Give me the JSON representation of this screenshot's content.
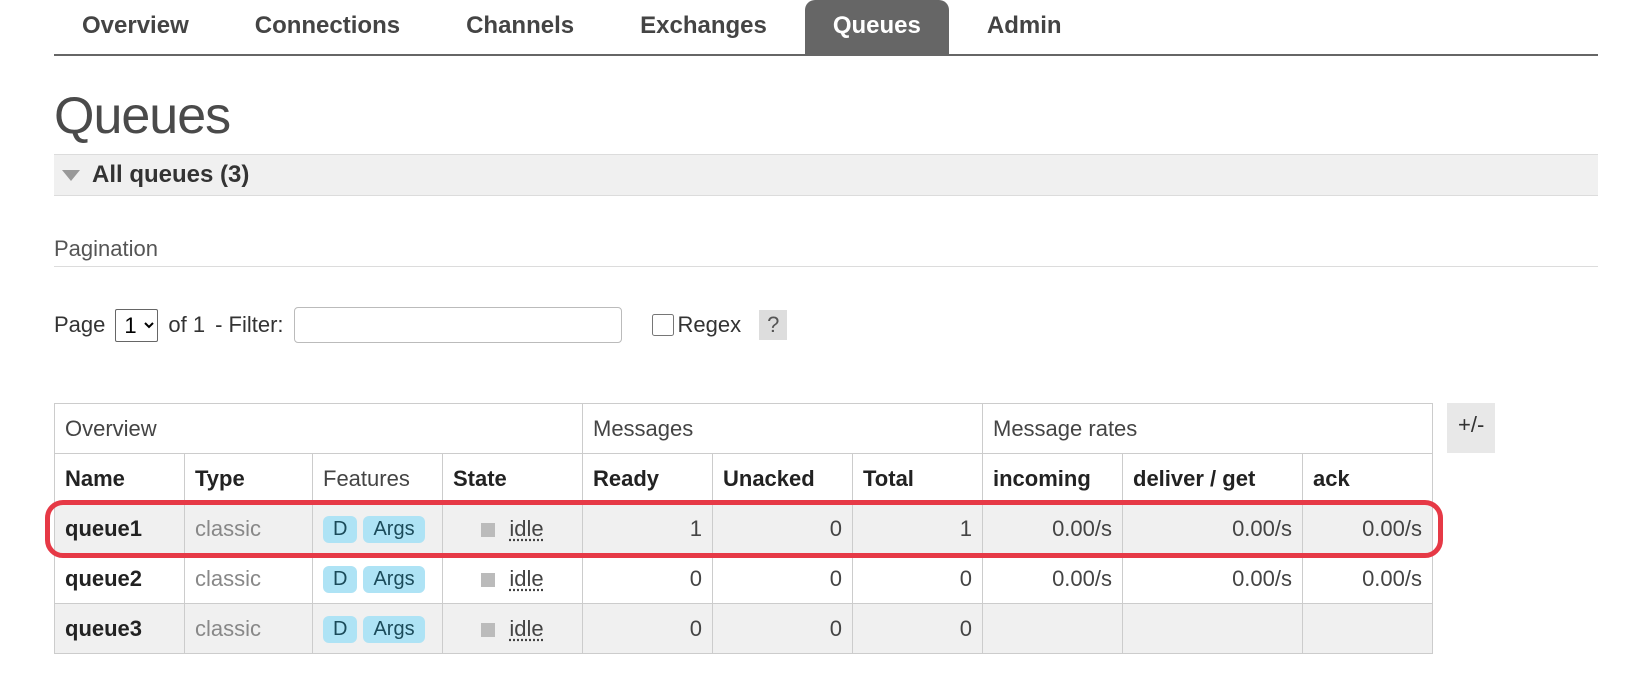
{
  "tabs": [
    {
      "label": "Overview",
      "active": false
    },
    {
      "label": "Connections",
      "active": false
    },
    {
      "label": "Channels",
      "active": false
    },
    {
      "label": "Exchanges",
      "active": false
    },
    {
      "label": "Queues",
      "active": true
    },
    {
      "label": "Admin",
      "active": false
    }
  ],
  "page_title": "Queues",
  "section_bar": {
    "label": "All queues (3)"
  },
  "pagination": {
    "legend": "Pagination",
    "page_label_left": "Page",
    "page_current": "1",
    "of_label": "of 1",
    "filter_label": "- Filter:",
    "filter_value": "",
    "regex_label": "Regex",
    "help": "?"
  },
  "table": {
    "group_headers": {
      "overview": "Overview",
      "messages": "Messages",
      "rates": "Message rates"
    },
    "columns": {
      "name": "Name",
      "type": "Type",
      "features": "Features",
      "state": "State",
      "ready": "Ready",
      "unacked": "Unacked",
      "total": "Total",
      "incoming": "incoming",
      "deliver": "deliver / get",
      "ack": "ack"
    },
    "plus_minus": "+/-",
    "state_idle": "idle",
    "rows": [
      {
        "name": "queue1",
        "type": "classic",
        "features": [
          "D",
          "Args"
        ],
        "state": "idle",
        "ready": "1",
        "unacked": "0",
        "total": "1",
        "incoming": "0.00/s",
        "deliver": "0.00/s",
        "ack": "0.00/s",
        "highlight": true
      },
      {
        "name": "queue2",
        "type": "classic",
        "features": [
          "D",
          "Args"
        ],
        "state": "idle",
        "ready": "0",
        "unacked": "0",
        "total": "0",
        "incoming": "0.00/s",
        "deliver": "0.00/s",
        "ack": "0.00/s",
        "highlight": false
      },
      {
        "name": "queue3",
        "type": "classic",
        "features": [
          "D",
          "Args"
        ],
        "state": "idle",
        "ready": "0",
        "unacked": "0",
        "total": "0",
        "incoming": "",
        "deliver": "",
        "ack": "",
        "highlight": false
      }
    ]
  },
  "highlight_color": "#e63946"
}
